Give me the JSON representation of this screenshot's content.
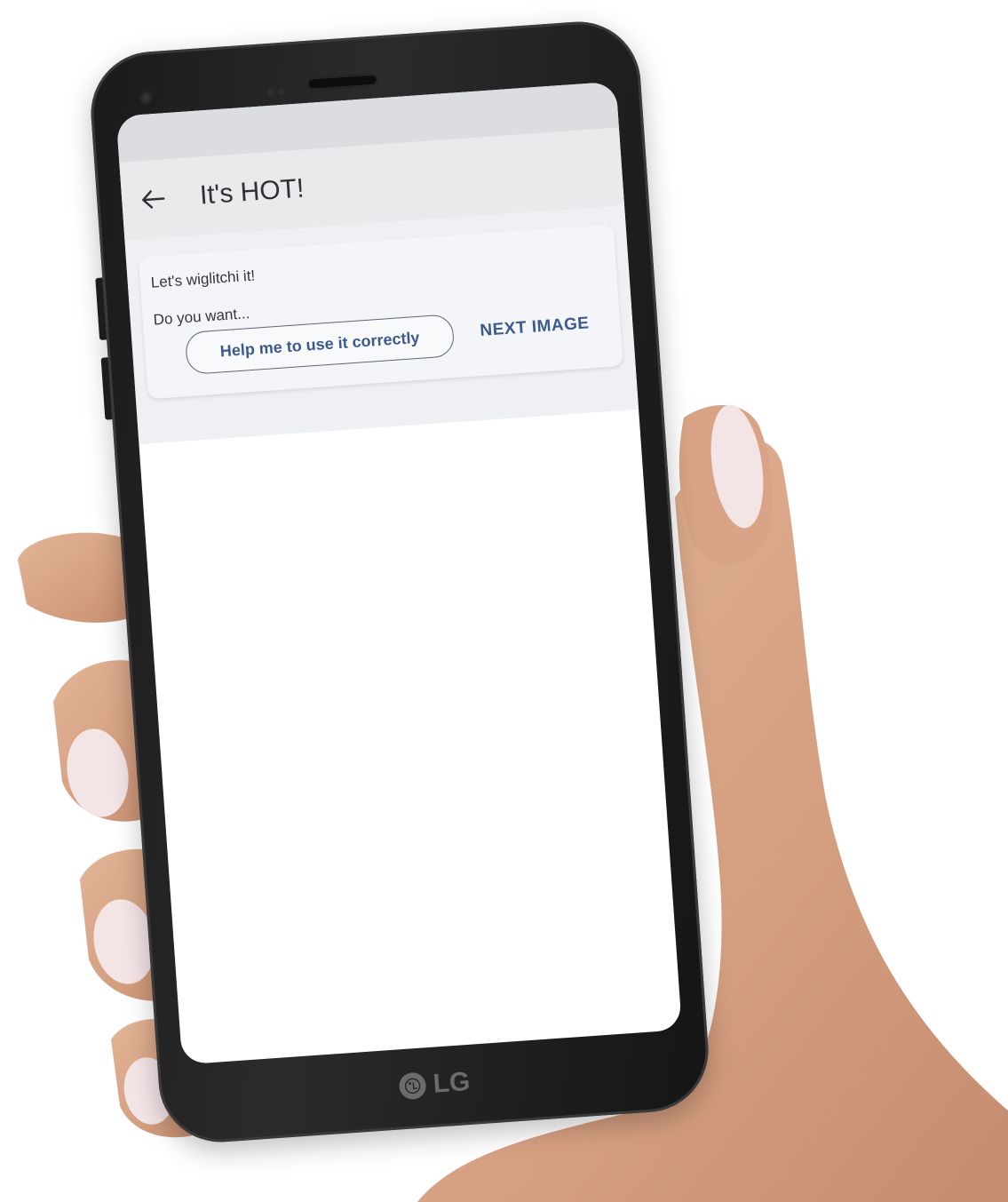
{
  "device": {
    "brand_label": "LG"
  },
  "app": {
    "title": "It's HOT!",
    "back_icon": "arrow-left-icon"
  },
  "message": {
    "greeting": "Let's wiglitchi it!",
    "question": "Do you want..."
  },
  "actions": {
    "help_label": "Help me to use it correctly",
    "next_label": "NEXT IMAGE"
  },
  "colors": {
    "accent": "#3d5a8c",
    "app_bar": "#e9eaec",
    "card": "#f4f5f8",
    "skin": "#d9a88a",
    "nail": "#f3e4e6"
  }
}
